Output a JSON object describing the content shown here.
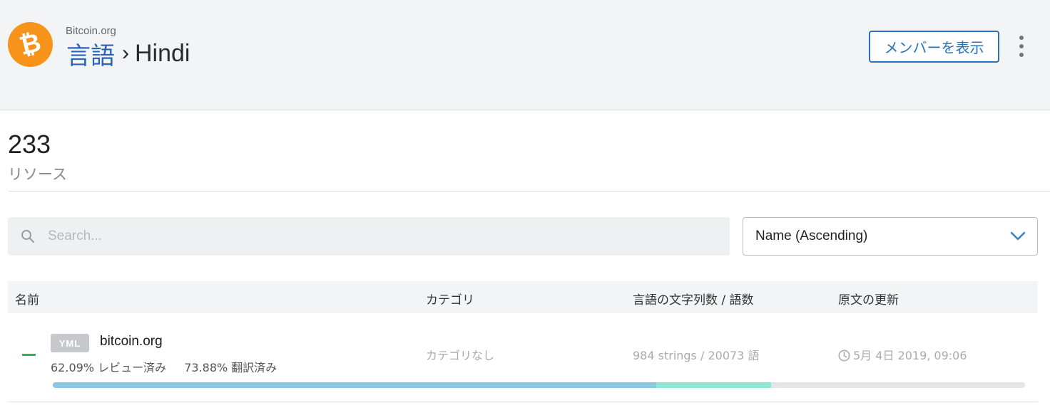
{
  "header": {
    "org_name": "Bitcoin.org",
    "breadcrumb_parent": "言語",
    "breadcrumb_separator": "›",
    "breadcrumb_current": "Hindi",
    "members_button": "メンバーを表示",
    "logo_icon": "bitcoin-logo",
    "more_icon": "kebab-menu-icon",
    "colors": {
      "logo": "#f7931a",
      "link": "#2a64b8",
      "button": "#2a72b5"
    }
  },
  "summary": {
    "resource_count": "233",
    "resource_label": "リソース"
  },
  "filters": {
    "search_placeholder": "Search...",
    "search_value": "",
    "sort_value": "Name (Ascending)"
  },
  "table": {
    "columns": [
      "名前",
      "カテゴリ",
      "言語の文字列数 / 語数",
      "原文の更新"
    ],
    "rows": [
      {
        "type_badge": "YML",
        "name": "bitcoin.org",
        "reviewed": "62.09% レビュー済み",
        "translated": "73.88% 翻訳済み",
        "category": "カテゴリなし",
        "counts": "984 strings / 20073 語",
        "updated": "5月 4日 2019, 09:06",
        "reviewed_fraction": 0.6209,
        "translated_fraction": 0.7388,
        "colors": {
          "reviewed": "#8ac7e3",
          "translated": "#8ee6d6",
          "status": "#3bad4b"
        }
      }
    ]
  }
}
